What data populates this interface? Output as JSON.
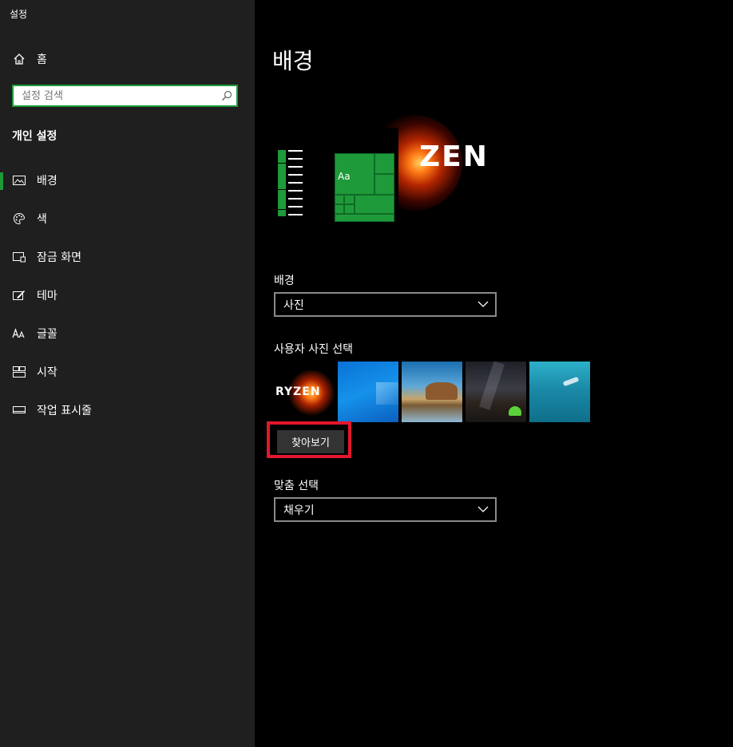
{
  "window": {
    "title": "설정"
  },
  "sidebar": {
    "home_label": "홈",
    "search_placeholder": "설정 검색",
    "section_title": "개인 설정",
    "items": [
      {
        "label": "배경",
        "icon": "image-icon",
        "active": true
      },
      {
        "label": "색",
        "icon": "palette-icon",
        "active": false
      },
      {
        "label": "잠금 화면",
        "icon": "lock-screen-icon",
        "active": false
      },
      {
        "label": "테마",
        "icon": "theme-brush-icon",
        "active": false
      },
      {
        "label": "글꼴",
        "icon": "font-icon",
        "active": false
      },
      {
        "label": "시작",
        "icon": "start-icon",
        "active": false
      },
      {
        "label": "작업 표시줄",
        "icon": "taskbar-icon",
        "active": false
      }
    ]
  },
  "main": {
    "page_title": "배경",
    "preview": {
      "brand_text": "ZEN",
      "tile_label": "Aa"
    },
    "background": {
      "label": "배경",
      "value": "사진"
    },
    "choose_picture": {
      "label": "사용자 사진 선택",
      "thumbnails": [
        {
          "name": "ryzen-wallpaper",
          "text": "RYZEN"
        },
        {
          "name": "windows-blue-wallpaper"
        },
        {
          "name": "beach-rock-wallpaper"
        },
        {
          "name": "night-sky-tent-wallpaper"
        },
        {
          "name": "underwater-diver-wallpaper"
        }
      ]
    },
    "browse_label": "찾아보기",
    "fit": {
      "label": "맞춤 선택",
      "value": "채우기"
    }
  },
  "colors": {
    "accent": "#1e9a3a",
    "highlight": "#e3172d",
    "sidebar_bg": "#1f1f1f",
    "main_bg": "#000000"
  }
}
